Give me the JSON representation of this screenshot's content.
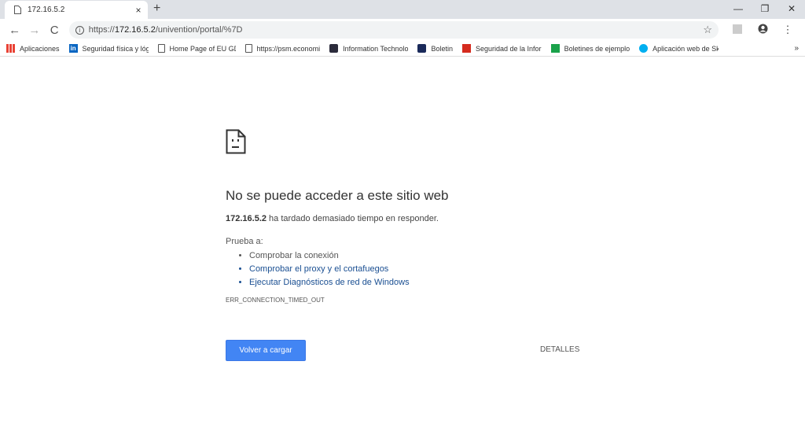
{
  "tab": {
    "title": "172.16.5.2",
    "close": "×",
    "new_tab": "+"
  },
  "window": {
    "minimize": "—",
    "restore": "❐",
    "close": "✕"
  },
  "toolbar": {
    "back": "←",
    "forward": "→",
    "reload": "C",
    "url_scheme": "https://",
    "url_host": "172.16.5.2",
    "url_path": "/univention/portal/%7D",
    "star": "☆",
    "menu": "⋮"
  },
  "bookmarks": [
    {
      "label": "Aplicaciones",
      "icon": "apps-icon",
      "color": "#e94235"
    },
    {
      "label": "Seguridad física y lóg",
      "icon": "linkedin-icon",
      "color": "#0a66c2"
    },
    {
      "label": "Home Page of EU GD",
      "icon": "page-icon",
      "color": ""
    },
    {
      "label": "https://psm.economi",
      "icon": "page-icon",
      "color": ""
    },
    {
      "label": "Information Technolo",
      "icon": "site-icon",
      "color": "#2b2b3b"
    },
    {
      "label": "Boletin",
      "icon": "site-icon",
      "color": "#1a2a5a"
    },
    {
      "label": "Seguridad de la Infor",
      "icon": "flag-icon",
      "color": "#d52b1e"
    },
    {
      "label": "Boletines de ejemplo",
      "icon": "uv-icon",
      "color": "#1aa24a"
    },
    {
      "label": "Aplicación web de Sk",
      "icon": "skype-icon",
      "color": "#00aff0"
    }
  ],
  "bookmarks_more": "»",
  "error": {
    "title": "No se puede acceder a este sitio web",
    "host": "172.16.5.2",
    "message": " ha tardado demasiado tiempo en responder.",
    "try_label": "Prueba a:",
    "suggestions": [
      "Comprobar la conexión",
      "Comprobar el proxy y el cortafuegos",
      "Ejecutar Diagnósticos de red de Windows"
    ],
    "code": "ERR_CONNECTION_TIMED_OUT",
    "reload_button": "Volver a cargar",
    "details_button": "DETALLES"
  }
}
